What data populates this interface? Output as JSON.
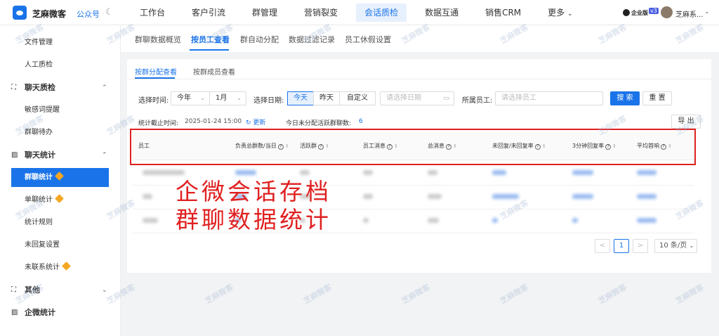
{
  "app": {
    "brand": "芝麻微客",
    "gzh": "公众号"
  },
  "nav": [
    "工作台",
    "客户引流",
    "群管理",
    "营销裂变",
    "会话质检",
    "数据互通",
    "销售CRM",
    "更多"
  ],
  "nav_active_index": 4,
  "account": {
    "edition": "企业版",
    "version": "v3",
    "name": "芝麻系..."
  },
  "sidebar": {
    "items": [
      {
        "label": "文件管理",
        "type": "sub"
      },
      {
        "label": "人工质检",
        "type": "sub"
      },
      {
        "label": "聊天质检",
        "type": "group",
        "icon": "scan-icon",
        "arrow": "^"
      },
      {
        "label": "敏感词提醒",
        "type": "sub"
      },
      {
        "label": "群聊待办",
        "type": "sub"
      },
      {
        "label": "聊天统计",
        "type": "group",
        "icon": "chart-icon",
        "arrow": "^"
      },
      {
        "label": "群聊统计",
        "type": "active",
        "badge": true
      },
      {
        "label": "单聊统计",
        "type": "sub",
        "badge": true
      },
      {
        "label": "统计规则",
        "type": "sub"
      },
      {
        "label": "未回复设置",
        "type": "sub"
      },
      {
        "label": "未联系统计",
        "type": "sub",
        "badge": true
      },
      {
        "label": "其他",
        "type": "group",
        "icon": "scan-icon",
        "arrow": "v"
      },
      {
        "label": "企微统计",
        "type": "group",
        "icon": "chart-icon",
        "arrow": ""
      }
    ]
  },
  "subtabs": [
    "群聊数据概览",
    "按员工查看",
    "群自动分配",
    "数据过滤记录",
    "员工休假设置"
  ],
  "subtab_active": 1,
  "inner_tabs": [
    "按群分配查看",
    "按群成员查看"
  ],
  "filters": {
    "time_label": "选择时间:",
    "year_value": "今年",
    "month_value": "1月",
    "date_label": "选择日期:",
    "seg": [
      "今天",
      "昨天",
      "自定义"
    ],
    "date_placeholder": "请选择日期",
    "staff_label": "所属员工:",
    "staff_placeholder": "请选择员工",
    "search": "搜 索",
    "reset": "重 置"
  },
  "stats": {
    "deadline_label": "统计截止时间:",
    "deadline_value": "2025-01-24 15:00",
    "refresh": "更新",
    "unassigned_label": "今日未分配活跃群聊数:",
    "unassigned_value": "6",
    "export": "导 出"
  },
  "table": {
    "columns": [
      "员工",
      "负责总群数/当日",
      "活跃群",
      "员工消息",
      "总消息",
      "未回复/未回复率",
      "3分钟回复率",
      "平均首响"
    ]
  },
  "overlay": {
    "line1": "企微会话存档",
    "line2": "群聊数据统计"
  },
  "pagination": {
    "prev": "<",
    "current": "1",
    "next": ">",
    "size": "10 条/页"
  },
  "watermark": "芝麻微客",
  "colors": {
    "accent": "#1a73e8",
    "highlight": "#e02020"
  }
}
